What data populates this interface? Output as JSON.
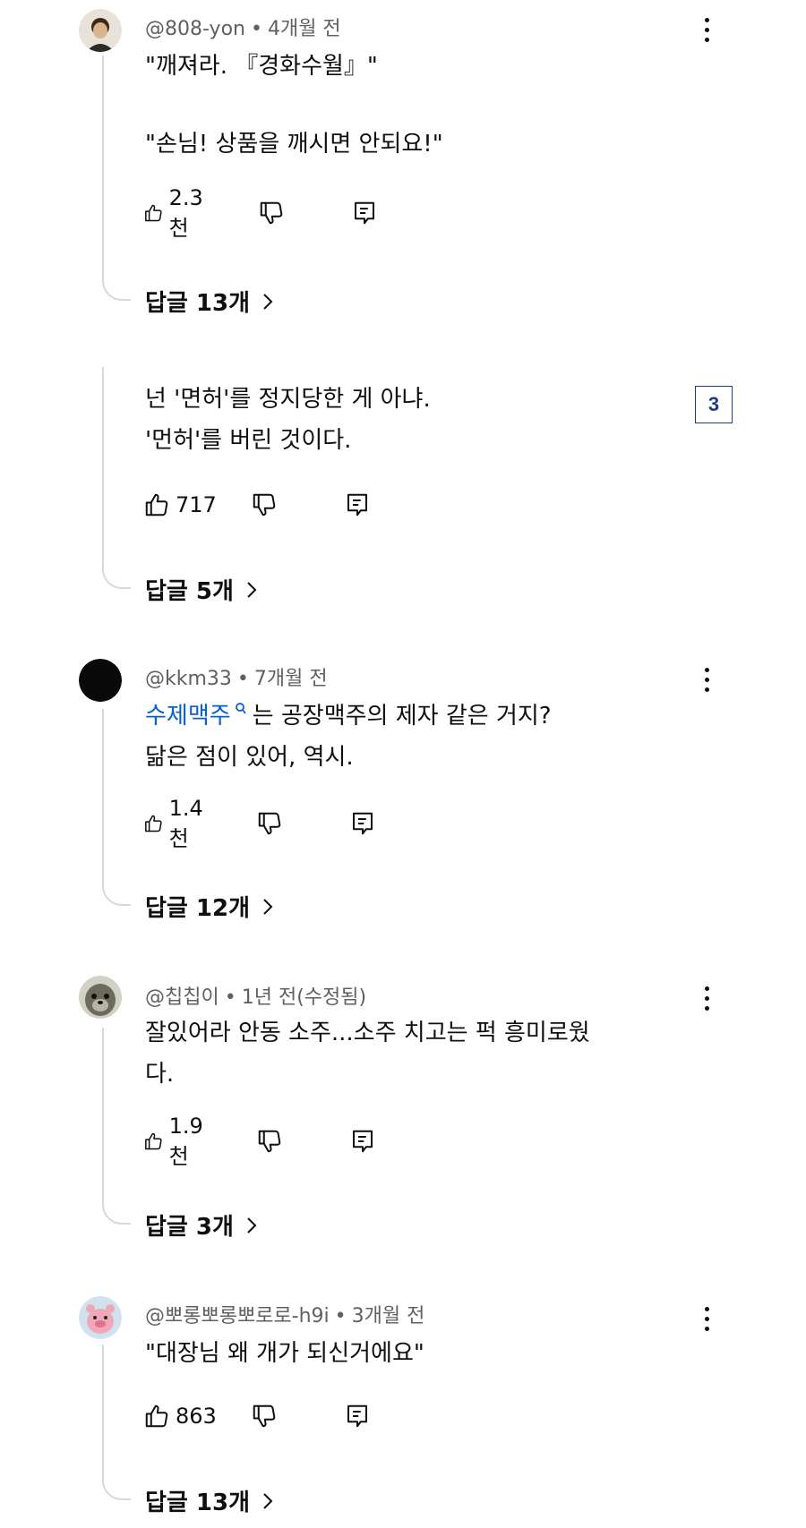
{
  "comments": [
    {
      "author": "@808-yon",
      "time": "4개월 전",
      "lines": [
        "\"깨져라. 『경화수월』\"",
        "",
        "\"손님! 상품을 깨시면 안되요!\""
      ],
      "likes": "2.3천",
      "replies": "답글 13개"
    },
    {
      "lines": [
        "넌 '면허'를 정지당한 게 아냐.",
        "'먼허'를 버린 것이다."
      ],
      "likes": "717",
      "replies": "답글 5개",
      "badge": "3"
    },
    {
      "author": "@kkm33",
      "time": "7개월 전",
      "mention": "수제맥주",
      "line1_rest": "는 공장맥주의 제자 같은 거지?",
      "line2": "닮은 점이 있어, 역시.",
      "likes": "1.4천",
      "replies": "답글 12개"
    },
    {
      "author": "@칩칩이",
      "time": "1년 전(수정됨)",
      "lines": [
        "잘있어라 안동 소주...소주 치고는 퍽 흥미로웠",
        "다."
      ],
      "likes": "1.9천",
      "replies": "답글 3개"
    },
    {
      "author": "@뽀롱뽀롱뽀로로-h9i",
      "time": "3개월 전",
      "lines": [
        "\"대장님 왜 개가 되신거에요\""
      ],
      "likes": "863",
      "replies": "답글 13개"
    }
  ],
  "icons": [
    "like-icon",
    "dislike-icon",
    "reply-icon",
    "more-icon",
    "chevron-right-icon",
    "search-icon"
  ],
  "colors": {
    "mention": "#065fd4",
    "meta": "#606060",
    "badge": "#1f3b8a"
  }
}
